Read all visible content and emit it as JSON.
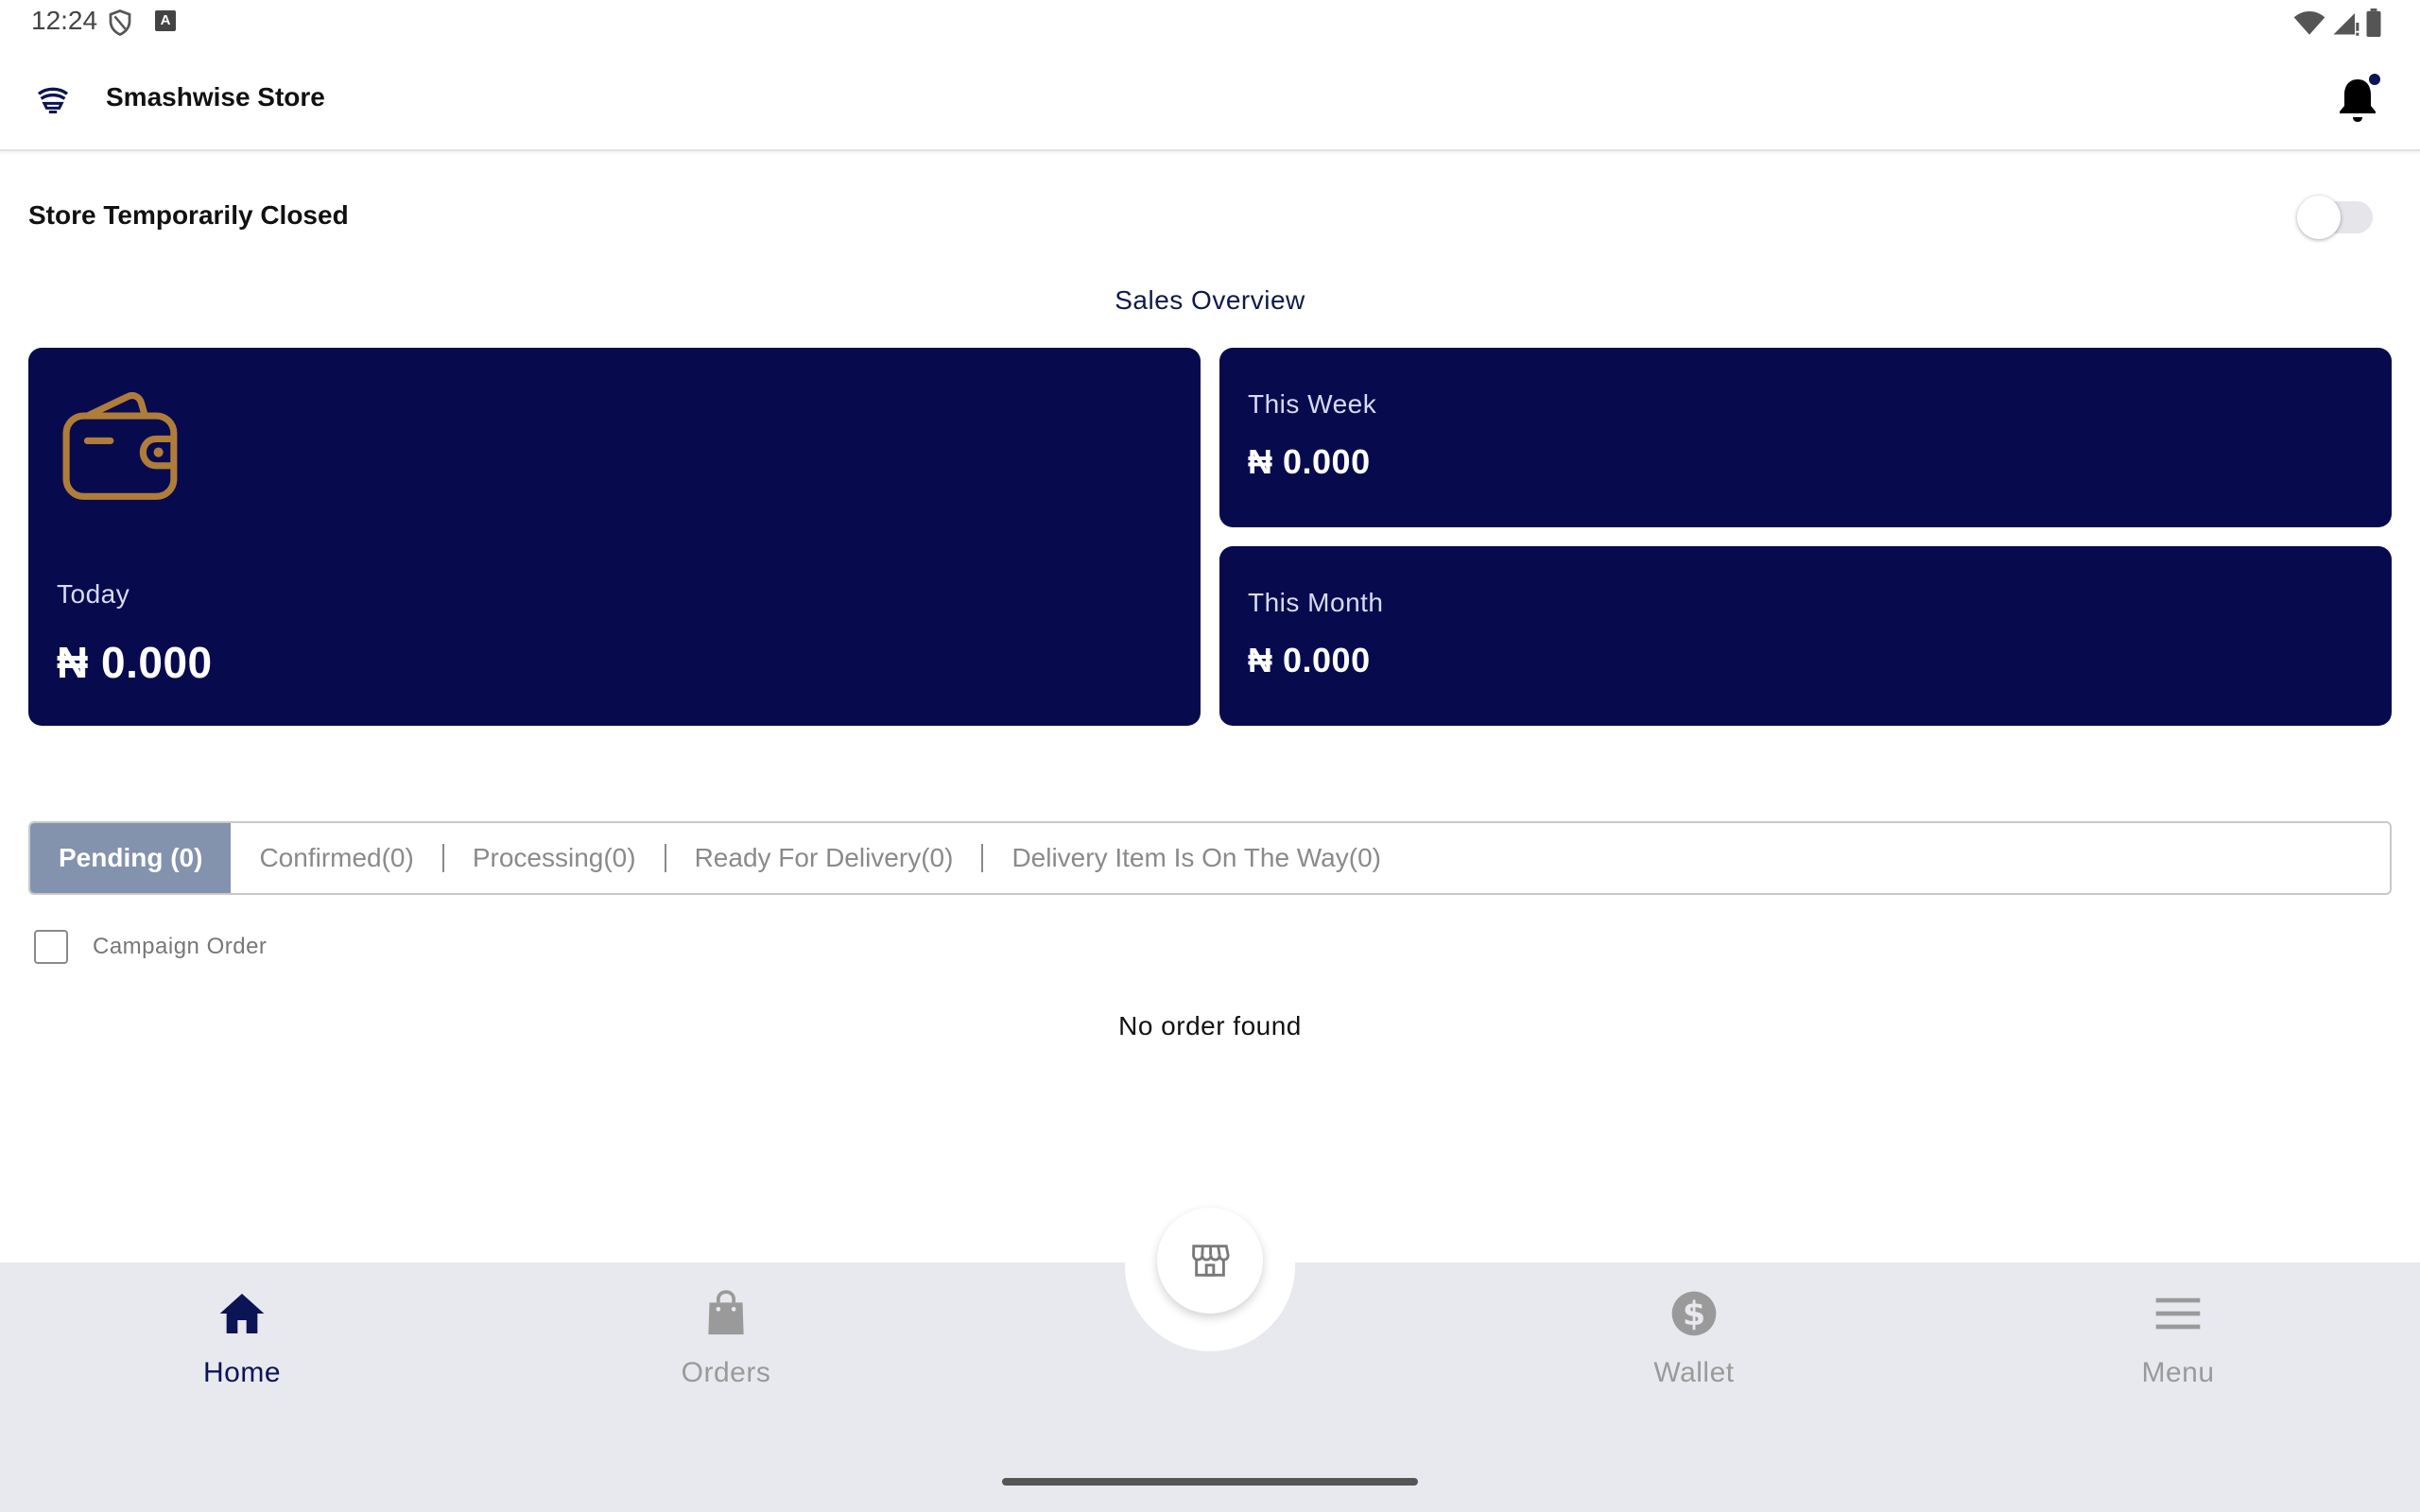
{
  "status_bar": {
    "time": "12:24",
    "left_icons": [
      "shield-icon",
      "a-box-icon"
    ],
    "right_icons": [
      "wifi-icon",
      "signal-icon",
      "battery-icon"
    ]
  },
  "header": {
    "title": "Smashwise Store",
    "logo_icon": "store-logo-icon",
    "notification_icon": "bell-icon",
    "notification_dot_color": "#0b1454"
  },
  "store_status": {
    "label": "Store Temporarily Closed",
    "toggle_on": false
  },
  "sales_overview": {
    "title": "Sales Overview",
    "today": {
      "label": "Today",
      "value": "₦ 0.000",
      "icon": "wallet-icon"
    },
    "this_week": {
      "label": "This Week",
      "value": "₦ 0.000"
    },
    "this_month": {
      "label": "This Month",
      "value": "₦ 0.000"
    },
    "card_color": "#070b4e",
    "icon_color": "#b07c3a"
  },
  "order_tabs": {
    "active": "Pending (0)",
    "items": [
      "Confirmed(0)",
      "Processing(0)",
      "Ready For Delivery(0)",
      "Delivery Item Is On The Way(0)"
    ]
  },
  "campaign_filter": {
    "label": "Campaign Order",
    "checked": false
  },
  "empty_state": "No order found",
  "bottom_nav": {
    "items": [
      {
        "label": "Home",
        "icon": "home-icon",
        "active": true
      },
      {
        "label": "Orders",
        "icon": "bag-icon",
        "active": false
      },
      {
        "label": "Wallet",
        "icon": "dollar-icon",
        "active": false
      },
      {
        "label": "Menu",
        "icon": "menu-icon",
        "active": false
      }
    ],
    "center_icon": "storefront-icon",
    "active_color": "#0b1454",
    "inactive_color": "#9a9a9a"
  }
}
